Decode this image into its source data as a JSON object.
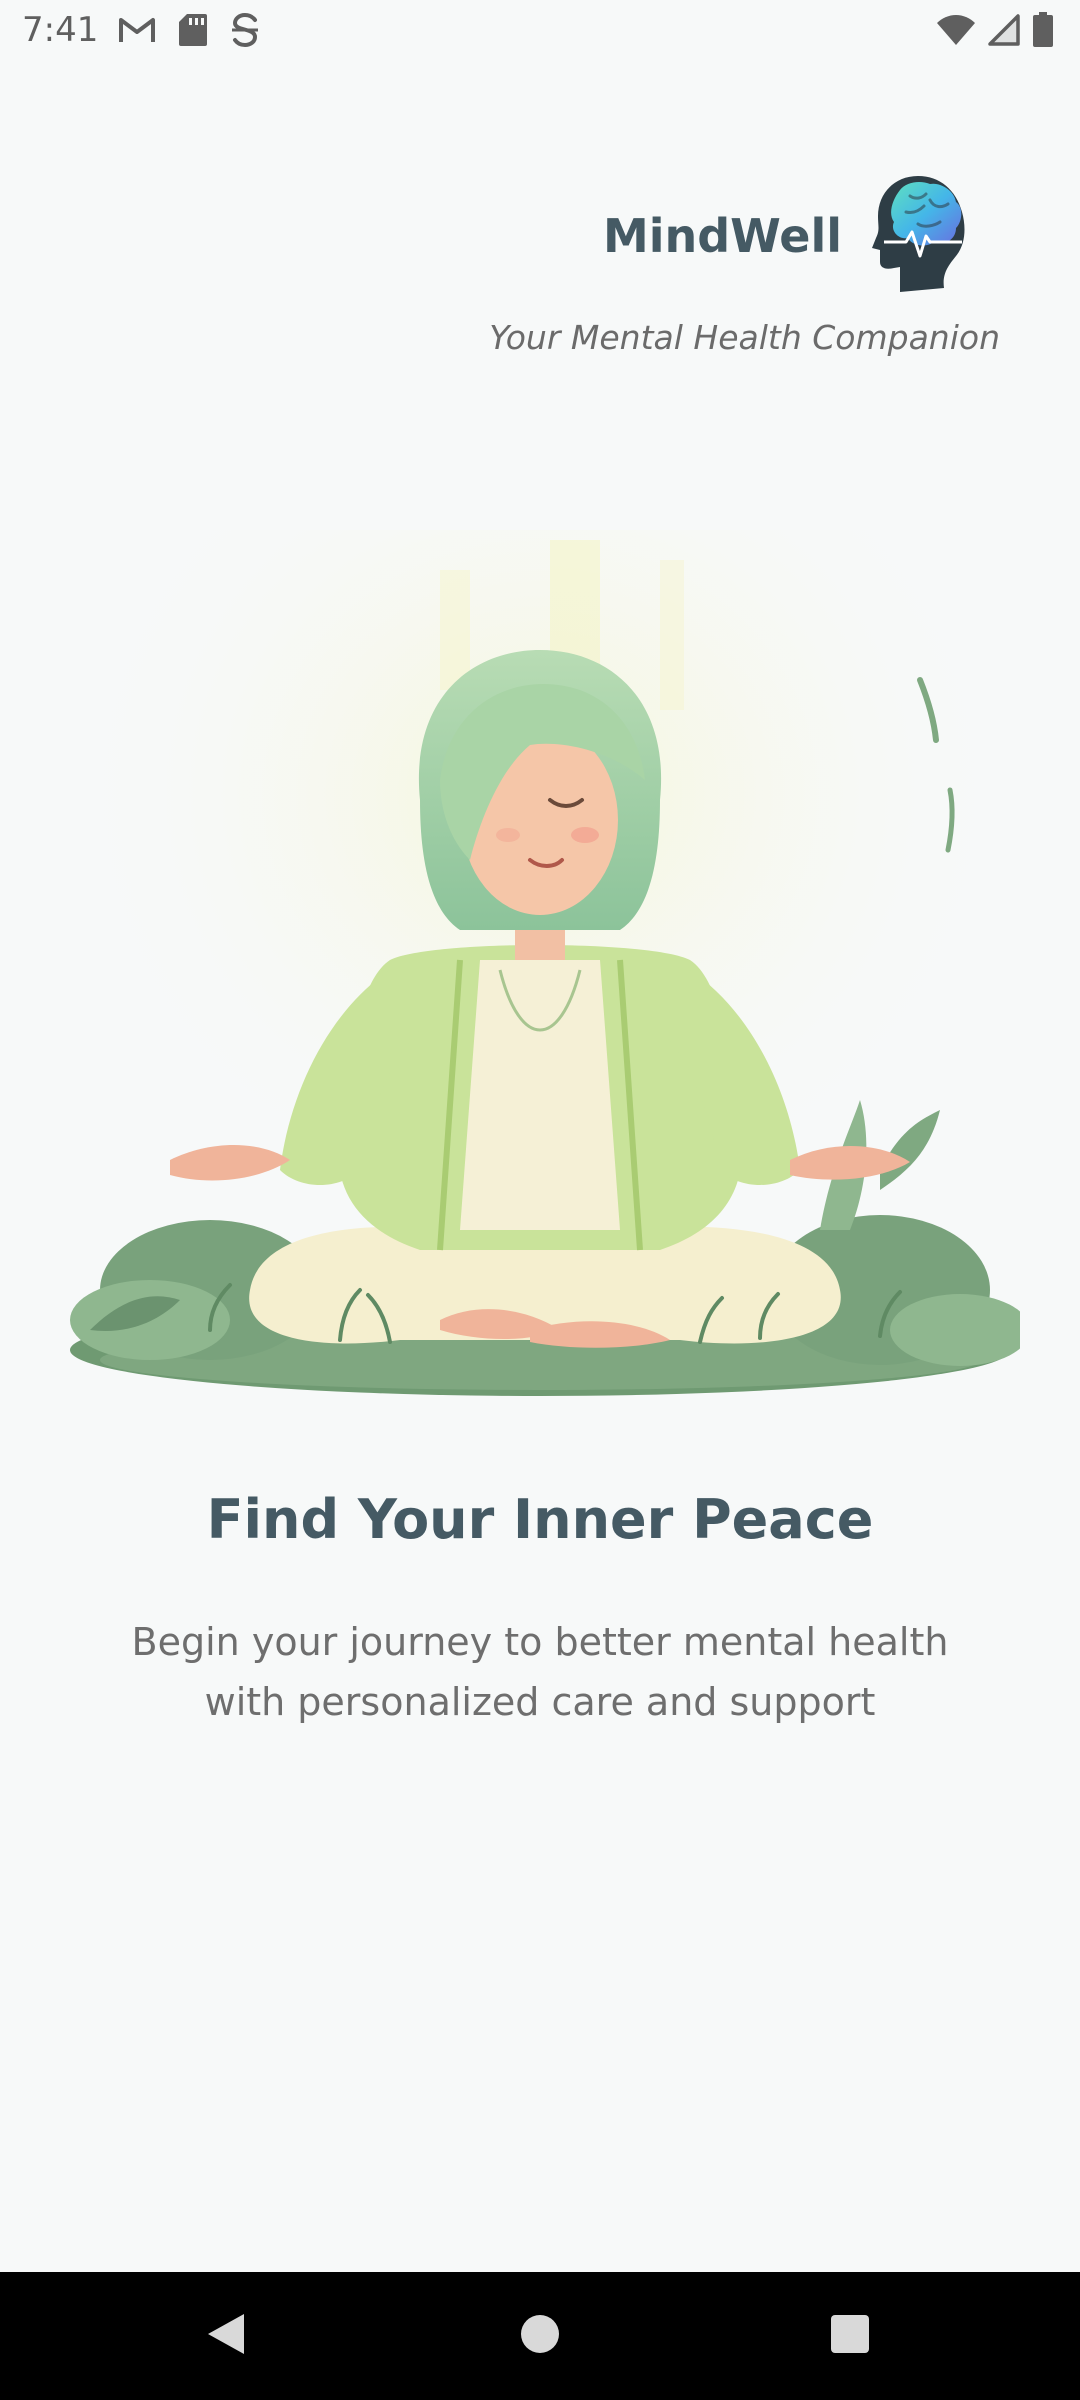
{
  "status_bar": {
    "time": "7:41",
    "left_icons": [
      "gmail-icon",
      "sd-card-icon",
      "sync-icon"
    ],
    "right_icons": [
      "wifi-icon",
      "signal-icon",
      "battery-icon"
    ]
  },
  "header": {
    "app_name": "MindWell",
    "tagline": "Your Mental Health Companion",
    "logo_icon": "brain-head-logo-icon"
  },
  "hero": {
    "illustration": "meditating-woman-illustration",
    "headline": "Find Your Inner Peace",
    "subtitle": "Begin your journey to better mental health with personalized care and support"
  },
  "navigation": {
    "back": "back-icon",
    "home": "home-icon",
    "recent": "recent-apps-icon"
  },
  "colors": {
    "background": "#f7f9f9",
    "brand_text": "#455a64",
    "secondary_text": "#6e6e6e",
    "accent_green": "#b7d97a",
    "nav_bar": "#000000"
  }
}
